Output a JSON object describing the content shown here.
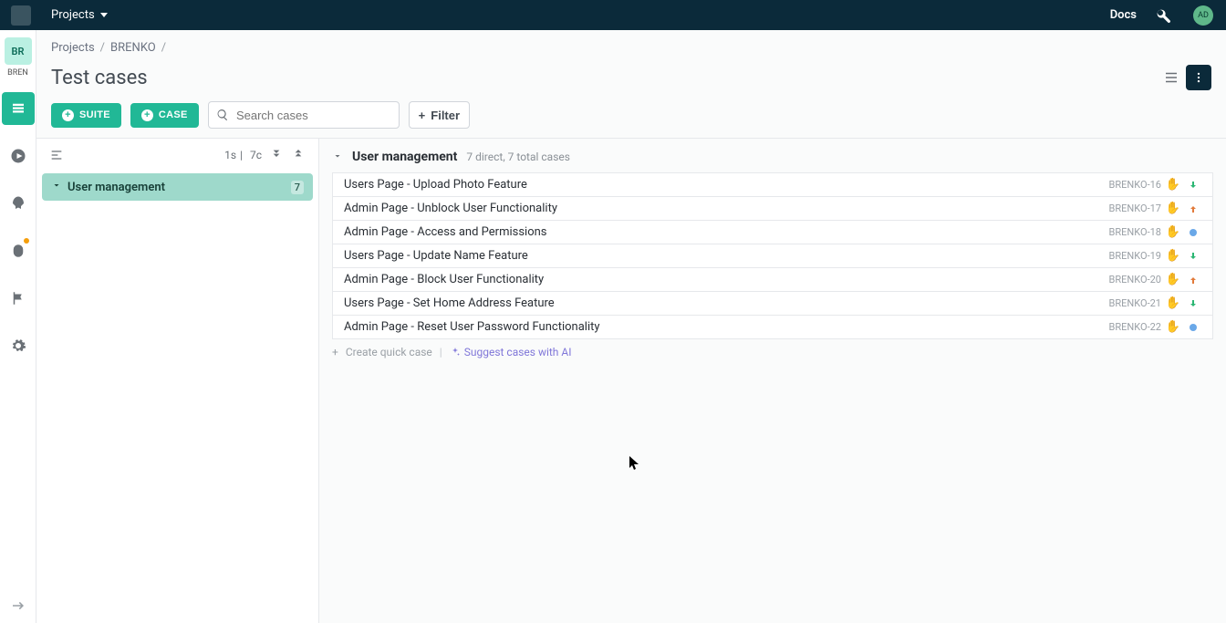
{
  "topbar": {
    "projects_label": "Projects",
    "docs_label": "Docs",
    "avatar_initials": "AD"
  },
  "rail": {
    "project_badge": "BR",
    "project_short": "BREN"
  },
  "breadcrumbs": {
    "root": "Projects",
    "project": "BRENKO"
  },
  "page_title": "Test cases",
  "toolbar": {
    "suite_btn": "SUITE",
    "case_btn": "CASE",
    "search_placeholder": "Search cases",
    "filter_label": "Filter"
  },
  "tree": {
    "suite_count_label": "1s",
    "case_count_label": "7c",
    "suite_name": "User management",
    "suite_badge": "7"
  },
  "section": {
    "title": "User management",
    "subtitle": "7 direct, 7 total cases"
  },
  "cases": [
    {
      "title": "Users Page - Upload Photo Feature",
      "id": "BRENKO-16",
      "priority": "low"
    },
    {
      "title": "Admin Page - Unblock User Functionality",
      "id": "BRENKO-17",
      "priority": "high"
    },
    {
      "title": "Admin Page - Access and Permissions",
      "id": "BRENKO-18",
      "priority": "med"
    },
    {
      "title": "Users Page - Update Name Feature",
      "id": "BRENKO-19",
      "priority": "low"
    },
    {
      "title": "Admin Page - Block User Functionality",
      "id": "BRENKO-20",
      "priority": "high"
    },
    {
      "title": "Users Page - Set Home Address Feature",
      "id": "BRENKO-21",
      "priority": "low"
    },
    {
      "title": "Admin Page - Reset User Password Functionality",
      "id": "BRENKO-22",
      "priority": "med"
    }
  ],
  "create_line": {
    "create_quick": "Create quick case",
    "suggest_ai": "Suggest cases with AI"
  }
}
